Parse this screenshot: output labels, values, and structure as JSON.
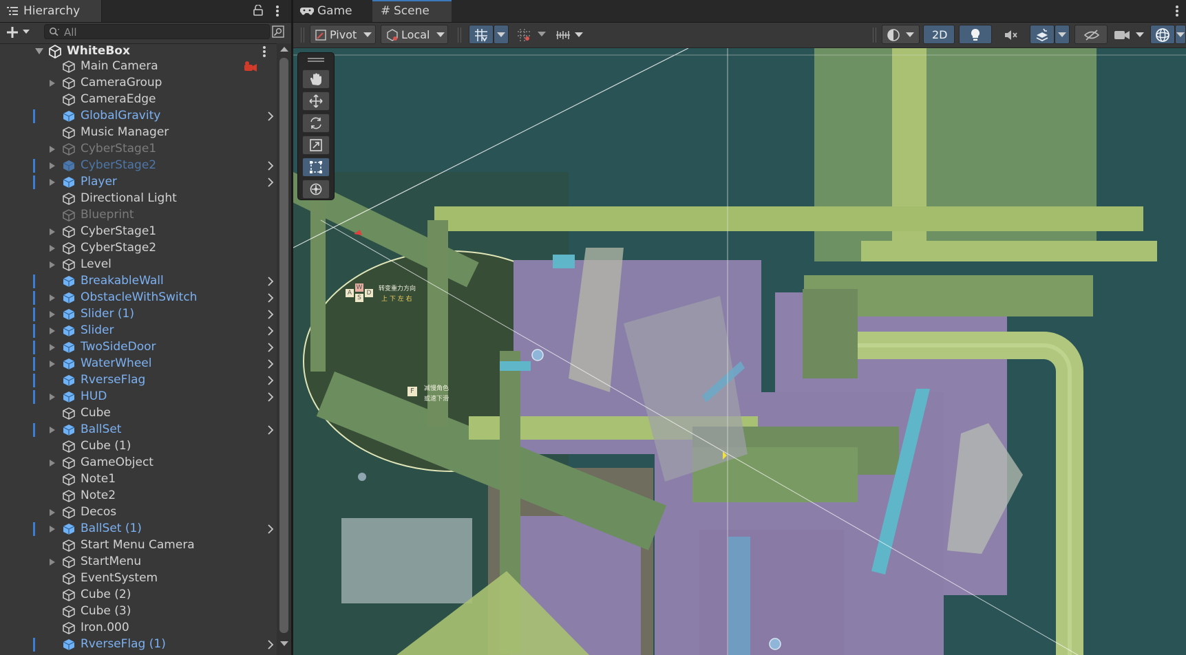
{
  "hierarchy": {
    "tab_label": "Hierarchy",
    "search_placeholder": "All",
    "root": "WhiteBox",
    "items": [
      {
        "label": "Main Camera",
        "style": "normal",
        "foldout": false,
        "prefab": false,
        "override": false,
        "chevron": false
      },
      {
        "label": "CameraGroup",
        "style": "normal",
        "foldout": true,
        "prefab": false,
        "override": false,
        "chevron": false
      },
      {
        "label": "CameraEdge",
        "style": "normal",
        "foldout": false,
        "prefab": false,
        "override": false,
        "chevron": false
      },
      {
        "label": "GlobalGravity",
        "style": "prefab",
        "foldout": false,
        "prefab": true,
        "override": true,
        "chevron": true
      },
      {
        "label": "Music Manager",
        "style": "normal",
        "foldout": false,
        "prefab": false,
        "override": false,
        "chevron": false
      },
      {
        "label": "CyberStage1",
        "style": "dim",
        "foldout": true,
        "prefab": false,
        "override": false,
        "chevron": false
      },
      {
        "label": "CyberStage2",
        "style": "prefab-dim",
        "foldout": true,
        "prefab": true,
        "override": true,
        "chevron": true
      },
      {
        "label": "Player",
        "style": "prefab",
        "foldout": true,
        "prefab": true,
        "override": true,
        "chevron": true
      },
      {
        "label": "Directional Light",
        "style": "normal",
        "foldout": false,
        "prefab": false,
        "override": false,
        "chevron": false
      },
      {
        "label": "Blueprint",
        "style": "dim",
        "foldout": false,
        "prefab": false,
        "override": false,
        "chevron": false
      },
      {
        "label": "CyberStage1",
        "style": "normal",
        "foldout": true,
        "prefab": false,
        "override": false,
        "chevron": false
      },
      {
        "label": "CyberStage2",
        "style": "normal",
        "foldout": true,
        "prefab": false,
        "override": false,
        "chevron": false
      },
      {
        "label": "Level",
        "style": "normal",
        "foldout": true,
        "prefab": false,
        "override": false,
        "chevron": false
      },
      {
        "label": "BreakableWall",
        "style": "prefab",
        "foldout": false,
        "prefab": true,
        "override": true,
        "chevron": true
      },
      {
        "label": "ObstacleWithSwitch",
        "style": "prefab",
        "foldout": true,
        "prefab": true,
        "override": true,
        "chevron": true
      },
      {
        "label": "Slider (1)",
        "style": "prefab",
        "foldout": true,
        "prefab": true,
        "override": true,
        "chevron": true
      },
      {
        "label": "Slider",
        "style": "prefab",
        "foldout": true,
        "prefab": true,
        "override": true,
        "chevron": true
      },
      {
        "label": "TwoSideDoor",
        "style": "prefab",
        "foldout": true,
        "prefab": true,
        "override": true,
        "chevron": true
      },
      {
        "label": "WaterWheel",
        "style": "prefab",
        "foldout": true,
        "prefab": true,
        "override": true,
        "chevron": true
      },
      {
        "label": "RverseFlag",
        "style": "prefab",
        "foldout": false,
        "prefab": true,
        "override": true,
        "chevron": true
      },
      {
        "label": "HUD",
        "style": "prefab",
        "foldout": true,
        "prefab": true,
        "override": true,
        "chevron": true
      },
      {
        "label": "Cube",
        "style": "normal",
        "foldout": false,
        "prefab": false,
        "override": false,
        "chevron": false
      },
      {
        "label": "BallSet",
        "style": "prefab",
        "foldout": true,
        "prefab": true,
        "override": true,
        "chevron": true
      },
      {
        "label": "Cube (1)",
        "style": "normal",
        "foldout": false,
        "prefab": false,
        "override": false,
        "chevron": false
      },
      {
        "label": "GameObject",
        "style": "normal",
        "foldout": true,
        "prefab": false,
        "override": false,
        "chevron": false
      },
      {
        "label": "Note1",
        "style": "normal",
        "foldout": false,
        "prefab": false,
        "override": false,
        "chevron": false
      },
      {
        "label": "Note2",
        "style": "normal",
        "foldout": false,
        "prefab": false,
        "override": false,
        "chevron": false
      },
      {
        "label": "Decos",
        "style": "normal",
        "foldout": true,
        "prefab": false,
        "override": false,
        "chevron": false
      },
      {
        "label": "BallSet (1)",
        "style": "prefab",
        "foldout": true,
        "prefab": true,
        "override": true,
        "chevron": true
      },
      {
        "label": "Start Menu Camera",
        "style": "normal",
        "foldout": false,
        "prefab": false,
        "override": false,
        "chevron": false
      },
      {
        "label": "StartMenu",
        "style": "normal",
        "foldout": true,
        "prefab": false,
        "override": false,
        "chevron": false
      },
      {
        "label": "EventSystem",
        "style": "normal",
        "foldout": false,
        "prefab": false,
        "override": false,
        "chevron": false
      },
      {
        "label": "Cube (2)",
        "style": "normal",
        "foldout": false,
        "prefab": false,
        "override": false,
        "chevron": false
      },
      {
        "label": "Cube (3)",
        "style": "normal",
        "foldout": false,
        "prefab": false,
        "override": false,
        "chevron": false
      },
      {
        "label": "Iron.000",
        "style": "normal",
        "foldout": false,
        "prefab": false,
        "override": false,
        "chevron": false
      },
      {
        "label": "RverseFlag (1)",
        "style": "prefab",
        "foldout": false,
        "prefab": true,
        "override": true,
        "chevron": true
      }
    ]
  },
  "scene": {
    "tabs": [
      {
        "label": "Game",
        "icon": "gamepad-icon",
        "active": false
      },
      {
        "label": "Scene",
        "icon": "hash-icon",
        "active": true
      }
    ],
    "toolbar": {
      "pivot_label": "Pivot",
      "local_label": "Local",
      "mode_2d_label": "2D"
    },
    "tools": [
      "hand-tool-icon",
      "move-tool-icon",
      "rotate-tool-icon",
      "scale-tool-icon",
      "rect-tool-icon",
      "transform-tool-icon"
    ],
    "active_tool": "rect-tool-icon",
    "annotations": {
      "gravity_keys": [
        "A",
        "W",
        "S",
        "D"
      ],
      "gravity_text_line1": "转变重力方向",
      "gravity_text_line2": "上 下 左 右",
      "f_key": "F",
      "f_text_line1": "减慢角色",
      "f_text_line2": "或速下滑"
    }
  },
  "colors": {
    "accent": "#3a79bb",
    "prefab_text": "#7cb1f2",
    "viewport_bg": "#2a5356",
    "platform_green": "#a9c172",
    "room_purple": "#8b80a8",
    "cyan": "#5fb6c8"
  }
}
